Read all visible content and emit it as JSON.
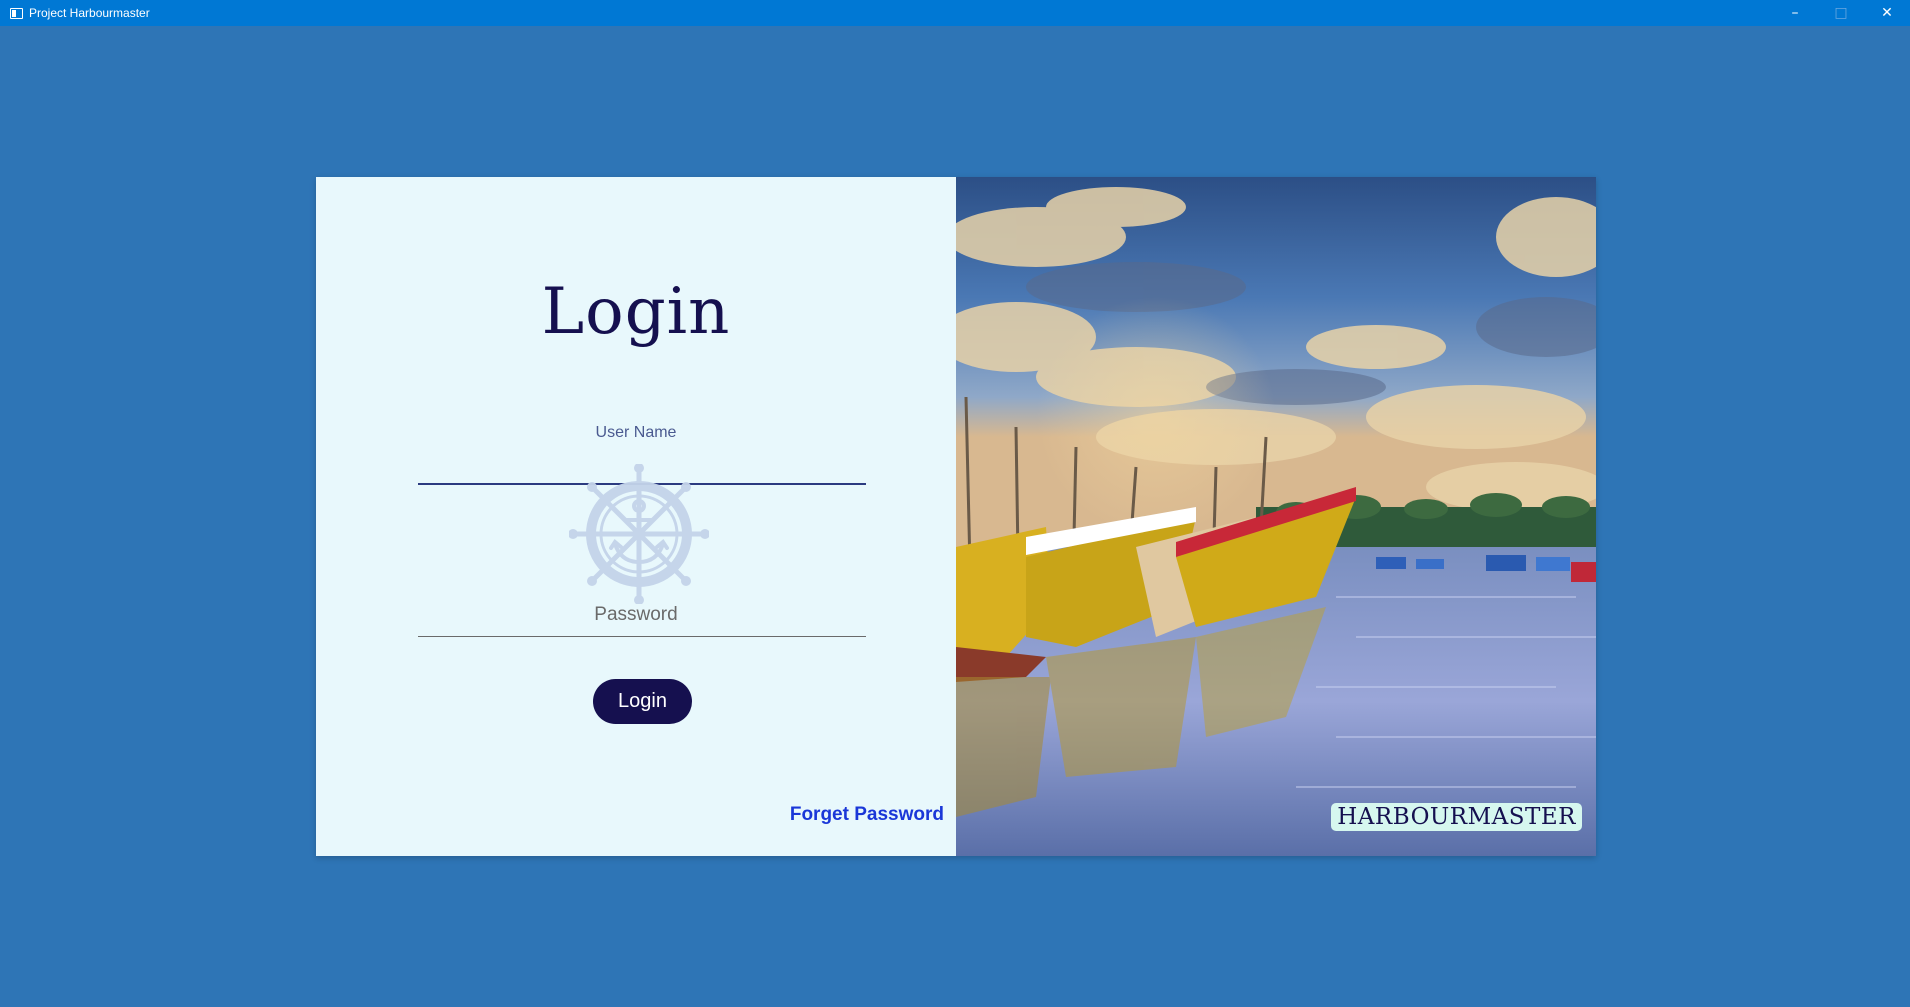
{
  "window": {
    "title": "Project Harbourmaster",
    "minimize_glyph": "–",
    "maximize_glyph": "□",
    "close_glyph": "✕"
  },
  "login": {
    "title": "Login",
    "username_label": "User Name",
    "username_value": "",
    "password_label": "Password",
    "password_value": "",
    "button_label": "Login",
    "forget_password": "Forget Password"
  },
  "hero": {
    "badge": "HARBOURMASTER",
    "image_description_icon": "harbour-boats-image"
  },
  "colors": {
    "background": "#2e75b6",
    "titlebar": "#0078d4",
    "panel": "#e8f8fc",
    "primary": "#15104f",
    "link": "#1a37d8",
    "badge": "#d6f7ef"
  }
}
